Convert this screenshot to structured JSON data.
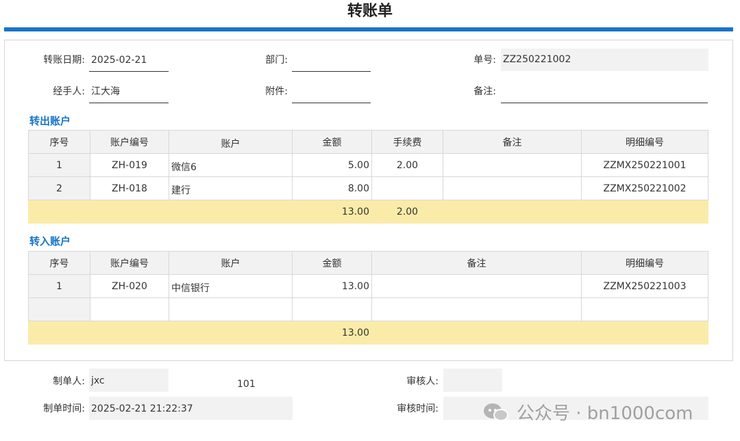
{
  "title": "转账单",
  "colors": {
    "accent": "#1874c9",
    "total_row": "#faeca8",
    "field_gray": "#f2f2f2"
  },
  "header": {
    "date_label": "转账日期:",
    "date_value": "2025-02-21",
    "dept_label": "部门:",
    "dept_value": "",
    "no_label": "单号:",
    "no_value": "ZZ250221002",
    "handler_label": "经手人:",
    "handler_value": "江大海",
    "attach_label": "附件:",
    "attach_value": "",
    "note_label": "备注:",
    "note_value": ""
  },
  "out_section": {
    "title": "转出账户",
    "columns": [
      "序号",
      "账户编号",
      "账户",
      "金额",
      "手续费",
      "备注",
      "明细编号"
    ],
    "rows": [
      {
        "seq": "1",
        "code": "ZH-019",
        "account": "微信6",
        "amount": "5.00",
        "fee": "2.00",
        "note": "",
        "detail_no": "ZZMX250221001"
      },
      {
        "seq": "2",
        "code": "ZH-018",
        "account": "建行",
        "amount": "8.00",
        "fee": "",
        "note": "",
        "detail_no": "ZZMX250221002"
      }
    ],
    "total_amount": "13.00",
    "total_fee": "2.00"
  },
  "in_section": {
    "title": "转入账户",
    "columns": [
      "序号",
      "账户编号",
      "账户",
      "金额",
      "备注",
      "明细编号"
    ],
    "rows": [
      {
        "seq": "1",
        "code": "ZH-020",
        "account": "中信银行",
        "amount": "13.00",
        "note": "",
        "detail_no": "ZZMX250221003"
      },
      {
        "seq": "",
        "code": "",
        "account": "",
        "amount": "",
        "note": "",
        "detail_no": ""
      }
    ],
    "total_amount": "13.00"
  },
  "footer": {
    "maker_label": "制单人:",
    "maker_value": "jxc",
    "maker_extra": "101",
    "make_time_label": "制单时间:",
    "make_time_value": "2025-02-21 21:22:37",
    "auditor_label": "审核人:",
    "auditor_value": "",
    "audit_time_label": "审核时间:",
    "audit_time_value": ""
  },
  "watermark": {
    "icon": "wechat-icon",
    "text": "公众号 · bn1000com"
  }
}
